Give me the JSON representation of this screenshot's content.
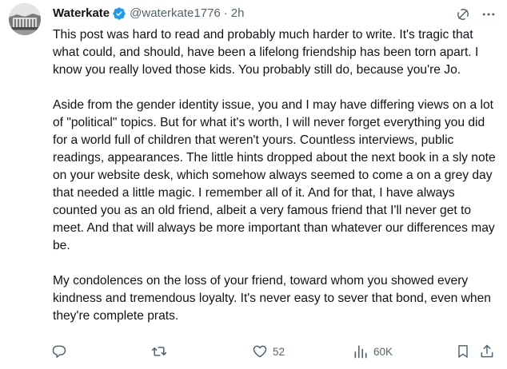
{
  "author": {
    "display_name": "Waterkate",
    "handle": "@waterkate1776",
    "separator": "·",
    "time": "2h",
    "verified": true,
    "verified_color": "#1d9bf0"
  },
  "header_icons": [
    "grok-icon",
    "more-options-icon"
  ],
  "body": {
    "paragraphs": [
      "This post was hard to read and probably much harder to write. It's tragic that what could, and should, have been a lifelong friendship has been torn apart. I know you really loved those kids. You probably still do, because you're Jo.",
      "Aside from the gender identity issue, you and I may have differing views on a lot of \"political\" topics. But for what it's worth, I will never forget everything you did for a world full of children that weren't yours. Countless interviews, public readings, appearances. The little hints dropped about the next book in a sly note on your website desk, which somehow always seemed to come a on a grey day that needed a little magic. I remember all of it. And for that, I have always counted you as an old friend, albeit a very famous friend that I'll never get to meet. And that will always be more important than whatever our differences may be.",
      "My condolences on the loss of your friend, toward whom you showed every kindness and tremendous loyalty. It's never easy to sever that bond, even when they're complete prats."
    ]
  },
  "actions": {
    "reply": {
      "icon": "reply-icon",
      "count": ""
    },
    "repost": {
      "icon": "repost-icon",
      "count": ""
    },
    "like": {
      "icon": "heart-icon",
      "count": "52"
    },
    "views": {
      "icon": "views-icon",
      "count": "60K"
    },
    "bookmark": {
      "icon": "bookmark-icon"
    },
    "share": {
      "icon": "share-icon"
    }
  },
  "colors": {
    "text": "#0f1419",
    "secondary": "#536471",
    "verified": "#1d9bf0"
  }
}
